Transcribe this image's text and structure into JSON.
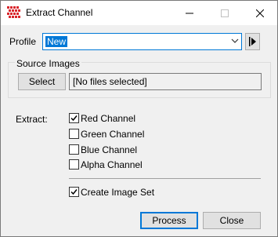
{
  "window": {
    "title": "Extract Channel",
    "minimize_icon": "minimize-icon",
    "maximize_icon": "maximize-icon",
    "close_icon": "close-icon",
    "app_icon": "channel-grid-icon",
    "accent_color": "#0078d7",
    "app_icon_color": "#d9262c"
  },
  "profile": {
    "label": "Profile",
    "value": "New",
    "dropdown_icon": "chevron-down-icon",
    "play_icon": "play-icon"
  },
  "source_images": {
    "title": "Source Images",
    "select_label": "Select",
    "files_text": "[No files selected]"
  },
  "extract": {
    "label": "Extract:",
    "options": [
      {
        "label": "Red Channel",
        "checked": true
      },
      {
        "label": "Green Channel",
        "checked": false
      },
      {
        "label": "Blue Channel",
        "checked": false
      },
      {
        "label": "Alpha Channel",
        "checked": false
      }
    ],
    "create_image_set": {
      "label": "Create Image Set",
      "checked": true
    }
  },
  "buttons": {
    "process_label": "Process",
    "close_label": "Close"
  }
}
